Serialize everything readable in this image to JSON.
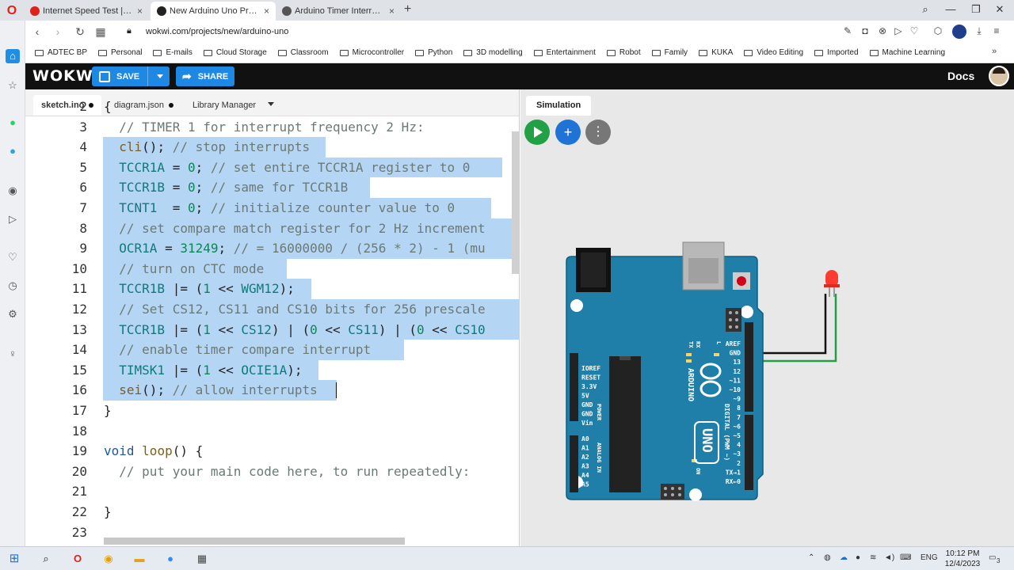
{
  "browser": {
    "tabs": [
      {
        "label": "Internet Speed Test | Fast.com",
        "close": "×"
      },
      {
        "label": "New Arduino Uno Project",
        "close": "×"
      },
      {
        "label": "Arduino Timer Interrupts C",
        "close": "×"
      }
    ],
    "new_tab": "+",
    "url": "wokwi.com/projects/new/arduino-uno",
    "bookmarks": [
      "ADTEC BP",
      "Personal",
      "E-mails",
      "Cloud Storage",
      "Classroom",
      "Microcontroller",
      "Python",
      "3D modelling",
      "Entertainment",
      "Robot",
      "Family",
      "KUKA",
      "Video Editing",
      "Imported",
      "Machine Learning"
    ],
    "bookmarks_more": "»"
  },
  "wokwi": {
    "logo": "WOKWi",
    "save_label": "SAVE",
    "share_label": "SHARE",
    "docs_label": "Docs"
  },
  "editor": {
    "tabs": [
      {
        "label": "sketch.ino",
        "modified": true
      },
      {
        "label": "diagram.json",
        "modified": true
      },
      {
        "label": "Library Manager",
        "modified": false
      }
    ]
  },
  "code_lines": [
    {
      "n": "2",
      "text": "{"
    },
    {
      "n": "3",
      "text": "  // TIMER 1 for interrupt frequency 2 Hz:"
    },
    {
      "n": "4",
      "text": "  cli(); // stop interrupts"
    },
    {
      "n": "5",
      "text": "  TCCR1A = 0; // set entire TCCR1A register to 0"
    },
    {
      "n": "6",
      "text": "  TCCR1B = 0; // same for TCCR1B"
    },
    {
      "n": "7",
      "text": "  TCNT1  = 0; // initialize counter value to 0"
    },
    {
      "n": "8",
      "text": "  // set compare match register for 2 Hz increment"
    },
    {
      "n": "9",
      "text": "  OCR1A = 31249; // = 16000000 / (256 * 2) - 1 (mu"
    },
    {
      "n": "10",
      "text": "  // turn on CTC mode"
    },
    {
      "n": "11",
      "text": "  TCCR1B |= (1 << WGM12);"
    },
    {
      "n": "12",
      "text": "  // Set CS12, CS11 and CS10 bits for 256 prescale"
    },
    {
      "n": "13",
      "text": "  TCCR1B |= (1 << CS12) | (0 << CS11) | (0 << CS10"
    },
    {
      "n": "14",
      "text": "  // enable timer compare interrupt"
    },
    {
      "n": "15",
      "text": "  TIMSK1 |= (1 << OCIE1A);"
    },
    {
      "n": "16",
      "text": "  sei(); // allow interrupts"
    },
    {
      "n": "17",
      "text": "}"
    },
    {
      "n": "18",
      "text": ""
    },
    {
      "n": "19",
      "text": "void loop() {"
    },
    {
      "n": "20",
      "text": "  // put your main code here, to run repeatedly:"
    },
    {
      "n": "21",
      "text": ""
    },
    {
      "n": "22",
      "text": "}"
    },
    {
      "n": "23",
      "text": ""
    }
  ],
  "simulation": {
    "tab_label": "Simulation",
    "add_label": "+",
    "more_label": "⋮",
    "board": {
      "brand": "ARDUINO",
      "model": "UNO",
      "on_label": "ON",
      "tx": "TX",
      "rx": "RX",
      "l": "L",
      "digital_label": "DIGITAL (PWM ~)",
      "analog_label": "ANALOG IN",
      "power_label": "POWER",
      "power_pins": [
        "IOREF",
        "RESET",
        "3.3V",
        "5V",
        "GND",
        "GND",
        "Vin"
      ],
      "analog_pins": [
        "A0",
        "A1",
        "A2",
        "A3",
        "A4",
        "A5"
      ],
      "digital_pins": [
        "AREF",
        "GND",
        "13",
        "12",
        "~11",
        "~10",
        "~9",
        "8",
        "7",
        "~6",
        "~5",
        "4",
        "~3",
        "2",
        "TX→1",
        "RX←0"
      ]
    },
    "colors": {
      "board": "#1f7fa8",
      "led": "#ff3b30",
      "wire_black": "#111111",
      "wire_green": "#22a046"
    }
  },
  "taskbar": {
    "language": "ENG",
    "time": "10:12 PM",
    "date": "12/4/2023",
    "notifications": "3"
  }
}
